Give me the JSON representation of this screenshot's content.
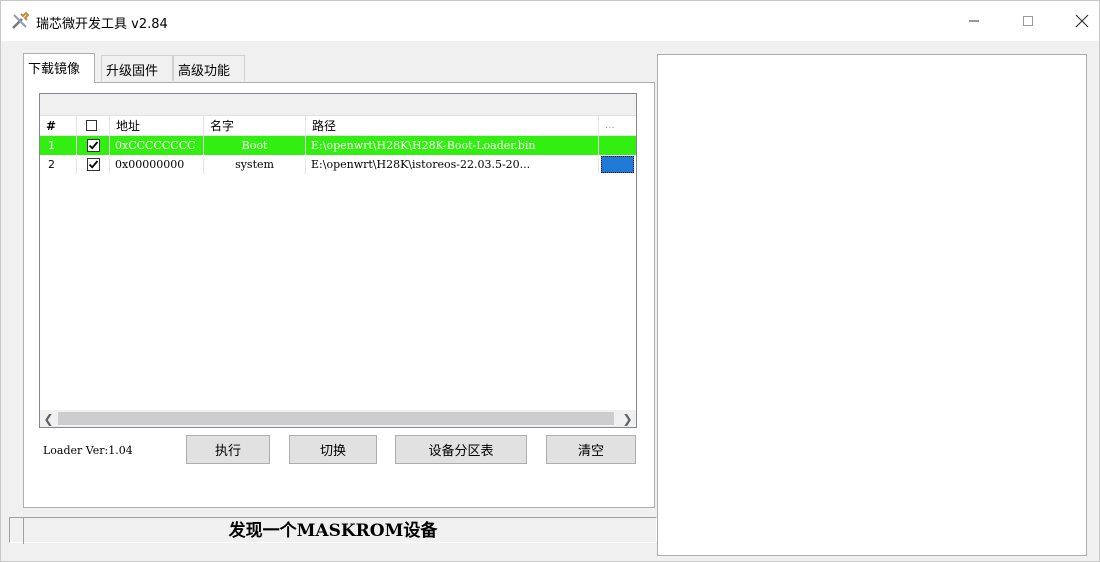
{
  "window": {
    "title": "瑞芯微开发工具 v2.84",
    "controls": {
      "minimize": "—",
      "maximize": "☐",
      "close": "✕"
    }
  },
  "tabs": [
    {
      "label": "下载镜像",
      "active": true
    },
    {
      "label": "升级固件",
      "active": false
    },
    {
      "label": "高级功能",
      "active": false
    }
  ],
  "table": {
    "headers": {
      "index": "#",
      "address": "地址",
      "name": "名字",
      "path": "路径",
      "more": "..."
    },
    "rows": [
      {
        "index": "1",
        "checked": true,
        "address": "0xCCCCCCCC",
        "name": "Boot",
        "path": "E:\\openwrt\\H28K\\H28K-Boot-Loader.bin",
        "highlight": "#33ee11"
      },
      {
        "index": "2",
        "checked": true,
        "address": "0x00000000",
        "name": "system",
        "path": "E:\\openwrt\\H28K\\istoreos-22.03.5-20...",
        "highlight": ""
      }
    ]
  },
  "loader_version": "Loader Ver:1.04",
  "buttons": {
    "execute": "执行",
    "switch": "切换",
    "partition_table": "设备分区表",
    "clear": "清空"
  },
  "status": {
    "message": "发现一个MASKROM设备"
  },
  "colors": {
    "row_highlight": "#33ee11",
    "selection_blue": "#1e7ad6"
  }
}
